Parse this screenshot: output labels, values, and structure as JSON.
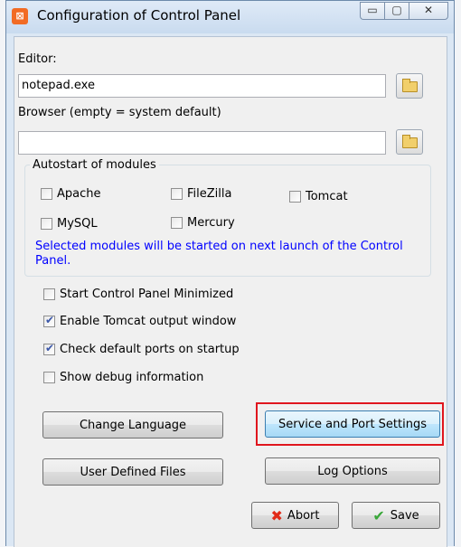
{
  "window": {
    "title": "Configuration of Control Panel",
    "app_icon_glyph": "⊠",
    "controls": {
      "minimize": "▭",
      "maximize": "▢",
      "close": "✕"
    }
  },
  "editor": {
    "label": "Editor:",
    "value": "notepad.exe"
  },
  "browser": {
    "label": "Browser (empty = system default)",
    "value": ""
  },
  "autostart": {
    "title": "Autostart of modules",
    "modules": [
      {
        "label": "Apache",
        "checked": false
      },
      {
        "label": "FileZilla",
        "checked": false
      },
      {
        "label": "Tomcat",
        "checked": false
      },
      {
        "label": "MySQL",
        "checked": false
      },
      {
        "label": "Mercury",
        "checked": false
      }
    ],
    "note": "Selected modules will be started on next launch of the Control Panel."
  },
  "options": [
    {
      "label": "Start Control Panel Minimized",
      "checked": false
    },
    {
      "label": "Enable Tomcat output window",
      "checked": true
    },
    {
      "label": "Check default ports on startup",
      "checked": true
    },
    {
      "label": "Show debug information",
      "checked": false
    }
  ],
  "buttons": {
    "change_language": "Change Language",
    "service_port": "Service and Port Settings",
    "user_defined_files": "User Defined Files",
    "log_options": "Log Options",
    "abort": "Abort",
    "save": "Save"
  },
  "icons": {
    "abort": "x-icon",
    "save": "checkmark-icon",
    "folder": "folder-icon"
  },
  "colors": {
    "highlight_box": "#e0161e",
    "note_text": "#0000ff"
  }
}
